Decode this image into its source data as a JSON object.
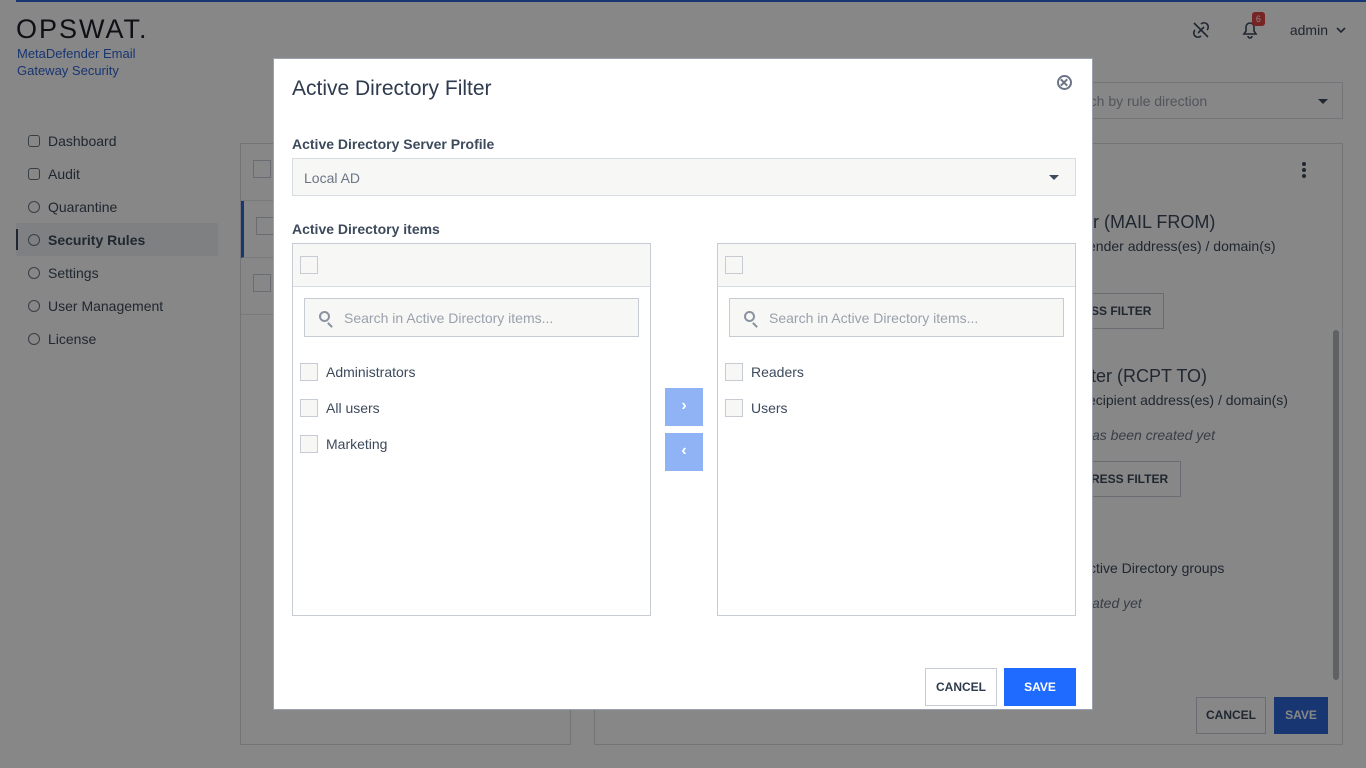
{
  "app": {
    "logo": "OPSWAT.",
    "product": "MetaDefender Email Gateway Security"
  },
  "header": {
    "notifications_count": "6",
    "user": "admin"
  },
  "sidebar": {
    "items": [
      {
        "label": "Dashboard",
        "icon": "grid-icon"
      },
      {
        "label": "Audit",
        "icon": "audit-icon"
      },
      {
        "label": "Quarantine",
        "icon": "globe-icon"
      },
      {
        "label": "Security Rules",
        "icon": "shield-icon",
        "active": true
      },
      {
        "label": "Settings",
        "icon": "gear-icon"
      },
      {
        "label": "User Management",
        "icon": "user-icon"
      },
      {
        "label": "License",
        "icon": "license-icon"
      }
    ]
  },
  "background": {
    "rule_direction_placeholder": "rch by rule direction",
    "sender_filter_title": "er (MAIL FROM)",
    "sender_filter_desc": "ender address(es) / domain(s)",
    "sender_filter_btn": "SS FILTER",
    "recipient_filter_title": "ilter (RCPT TO)",
    "recipient_filter_desc": "ecipient address(es) / domain(s)",
    "recipient_filter_empty": "as been created yet",
    "recipient_filter_btn": "RESS FILTER",
    "ad_groups_title": "ctive Directory groups",
    "ad_groups_empty": "ated yet",
    "cancel_label": "CANCEL",
    "save_label": "SAVE"
  },
  "modal": {
    "title": "Active Directory Filter",
    "server_profile_label": "Active Directory Server Profile",
    "server_profile_value": "Local AD",
    "items_label": "Active Directory items",
    "left_search_placeholder": "Search in Active Directory items...",
    "right_search_placeholder": "Search in Active Directory items...",
    "left_items": [
      "Administrators",
      "All users",
      "Marketing"
    ],
    "right_items": [
      "Readers",
      "Users"
    ],
    "move_right": "›",
    "move_left": "‹",
    "cancel_label": "CANCEL",
    "save_label": "SAVE"
  },
  "colors": {
    "accent": "#1f6bff",
    "arrow_disabled": "#8fb3f5",
    "badge": "#e04545"
  }
}
